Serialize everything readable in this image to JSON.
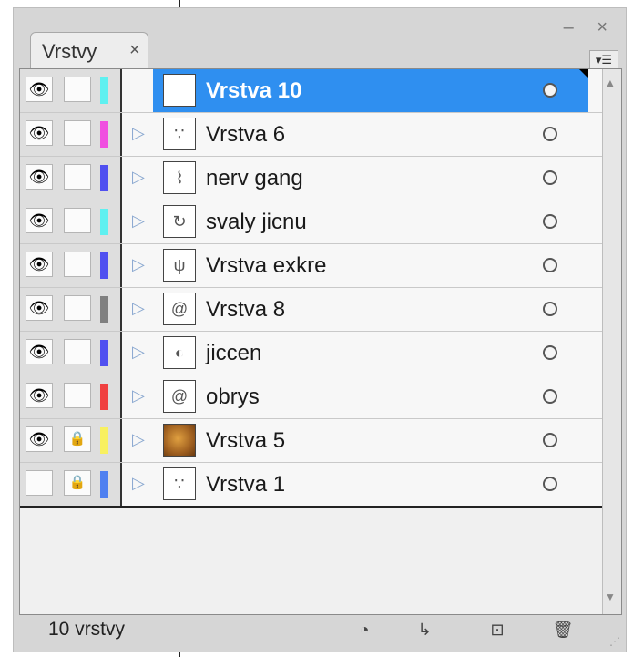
{
  "panel": {
    "tab_label": "Vrstvy",
    "tab_close_icon": "close-icon",
    "window_controls": "– ×",
    "menu_icon": "panel-menu-icon"
  },
  "layers": [
    {
      "name": "Vrstva 10",
      "visible": true,
      "locked": false,
      "color": "#5ff0f0",
      "selected": true,
      "has_children": false,
      "thumb": "blank"
    },
    {
      "name": "Vrstva 6",
      "visible": true,
      "locked": false,
      "color": "#f04fe0",
      "selected": false,
      "has_children": true,
      "thumb": "dots"
    },
    {
      "name": "nerv gang",
      "visible": true,
      "locked": false,
      "color": "#5050f0",
      "selected": false,
      "has_children": true,
      "thumb": "sketch"
    },
    {
      "name": "svaly jicnu",
      "visible": true,
      "locked": false,
      "color": "#5ff0f0",
      "selected": false,
      "has_children": true,
      "thumb": "spiral"
    },
    {
      "name": "Vrstva exkre",
      "visible": true,
      "locked": false,
      "color": "#5050f0",
      "selected": false,
      "has_children": true,
      "thumb": "branch"
    },
    {
      "name": "Vrstva 8",
      "visible": true,
      "locked": false,
      "color": "#808080",
      "selected": false,
      "has_children": true,
      "thumb": "swirl"
    },
    {
      "name": "jiccen",
      "visible": true,
      "locked": false,
      "color": "#5050f0",
      "selected": false,
      "has_children": true,
      "thumb": "ring"
    },
    {
      "name": "obrys",
      "visible": true,
      "locked": false,
      "color": "#f04040",
      "selected": false,
      "has_children": true,
      "thumb": "swirl2"
    },
    {
      "name": "Vrstva 5",
      "visible": true,
      "locked": true,
      "color": "#f8f060",
      "selected": false,
      "has_children": true,
      "thumb": "photo"
    },
    {
      "name": "Vrstva 1",
      "visible": false,
      "locked": true,
      "color": "#4f80f0",
      "selected": false,
      "has_children": true,
      "thumb": "dots"
    }
  ],
  "footer": {
    "count_label": "10 vrstvy",
    "buttons": [
      "make-clipping-mask-icon",
      "create-sublayer-icon",
      "new-layer-icon",
      "delete-layer-icon"
    ]
  }
}
